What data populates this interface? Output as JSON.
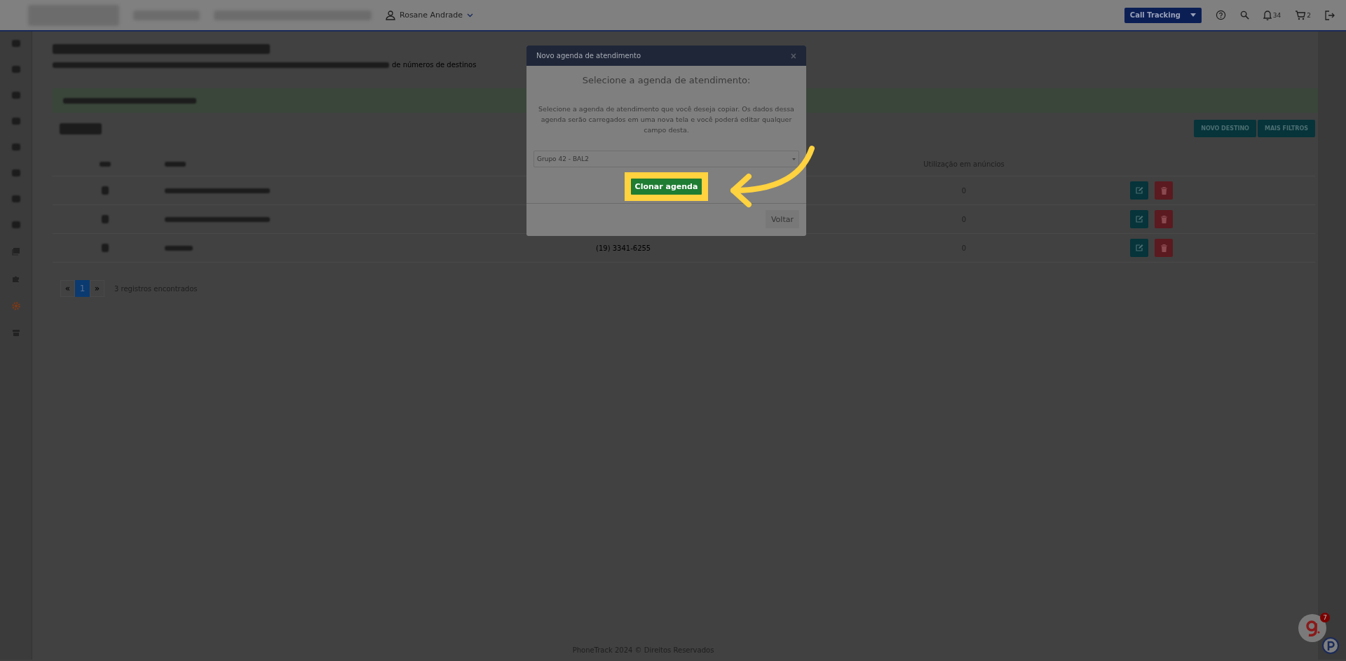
{
  "topbar": {
    "user": "Rosane Andrade",
    "product": "Call Tracking",
    "notifications": "34",
    "cart": "2"
  },
  "breadcrumb_tail": "de números de destinos",
  "toolbar_buttons": [
    "NOVO DESTINO",
    "MAIS FILTROS"
  ],
  "table": {
    "columns": [
      {
        "label": "Utilização em anúncios"
      }
    ],
    "rows": [
      {
        "usage": "0"
      },
      {
        "usage": "0"
      },
      {
        "destination": "(19) 3341-6255",
        "usage": "0"
      }
    ]
  },
  "pagination": {
    "prev": "«",
    "next": "»",
    "pages": [
      {
        "label": "1",
        "selected": true
      }
    ],
    "summary": "3 registros encontrados"
  },
  "footer": "PhoneTrack 2024 © Direitos Reservados",
  "chat_badge": "7",
  "modal": {
    "title": "Novo agenda de atendimento",
    "close": "×",
    "heading": "Selecione a agenda de atendimento:",
    "description": "Selecione a agenda de atendimento que você deseja copiar. Os dados dessa agenda serão carregados em uma nova tela e você poderá editar qualquer campo desta.",
    "select_value": "Grupo 42 - BAL2",
    "primary_button": "Clonar agenda",
    "secondary_button": "Voltar"
  }
}
